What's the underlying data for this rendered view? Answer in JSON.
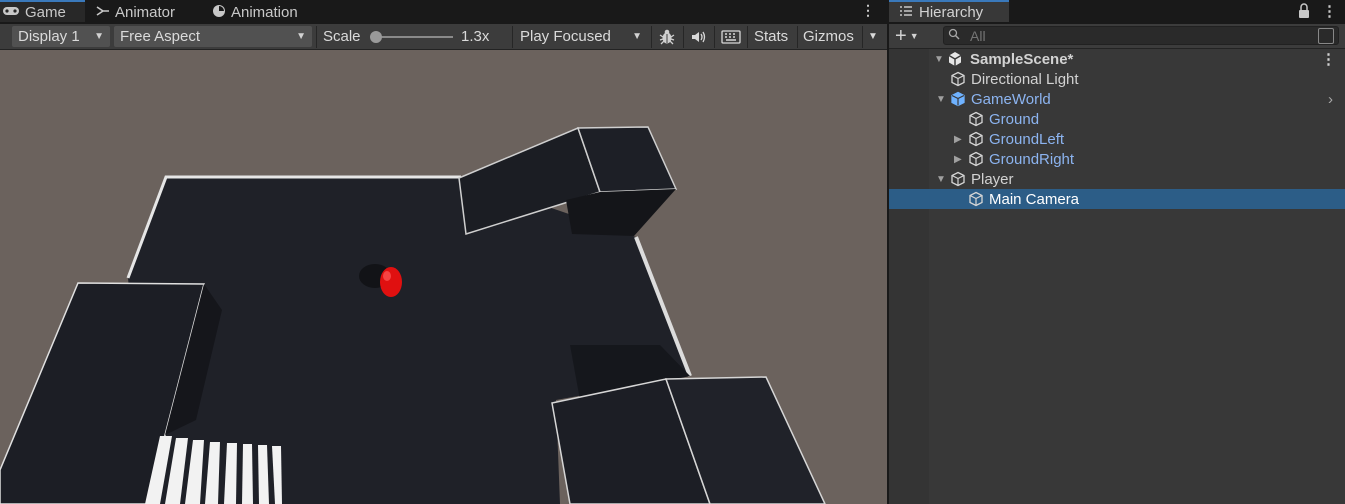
{
  "tabs": [
    {
      "label": "Game",
      "icon": "gamepad-icon",
      "active": true
    },
    {
      "label": "Animator",
      "icon": "animator-icon",
      "active": false
    },
    {
      "label": "Animation",
      "icon": "clock-icon",
      "active": false
    }
  ],
  "toolbar": {
    "display": "Display 1",
    "aspect": "Free Aspect",
    "scale_label": "Scale",
    "scale_value": "1.3x",
    "play_mode": "Play Focused",
    "stats": "Stats",
    "gizmos": "Gizmos"
  },
  "hierarchy": {
    "title": "Hierarchy",
    "search_placeholder": "All",
    "scene": "SampleScene*",
    "items": [
      {
        "label": "Directional Light",
        "depth": 1,
        "foldout": "none",
        "prefab": false
      },
      {
        "label": "GameWorld",
        "depth": 1,
        "foldout": "open",
        "prefab": true,
        "root_prefab": true
      },
      {
        "label": "Ground",
        "depth": 2,
        "foldout": "none",
        "prefab": true
      },
      {
        "label": "GroundLeft",
        "depth": 2,
        "foldout": "closed",
        "prefab": true
      },
      {
        "label": "GroundRight",
        "depth": 2,
        "foldout": "closed",
        "prefab": true
      },
      {
        "label": "Player",
        "depth": 1,
        "foldout": "open",
        "prefab": false
      },
      {
        "label": "Main Camera",
        "depth": 2,
        "foldout": "none",
        "prefab": false,
        "selected": true
      }
    ]
  },
  "colors": {
    "accent": "#3a79bb",
    "selection": "#2c5d87",
    "prefab_text": "#8cb4f0",
    "viewport_bg": "#6b625d",
    "player_ball": "#e01010"
  }
}
